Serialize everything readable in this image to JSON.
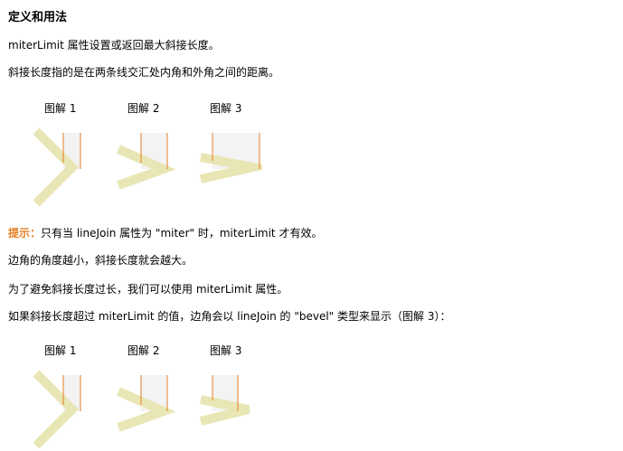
{
  "heading": "定义和用法",
  "p1": "miterLimit 属性设置或返回最大斜接长度。",
  "p2": "斜接长度指的是在两条线交汇处内角和外角之间的距离。",
  "captions_top": [
    "图解 1",
    "图解 2",
    "图解 3"
  ],
  "tip_label": "提示：",
  "tip_text": "只有当 lineJoin 属性为 \"miter\" 时，miterLimit 才有效。",
  "p3": "边角的角度越小，斜接长度就会越大。",
  "p4": "为了避免斜接长度过长，我们可以使用 miterLimit 属性。",
  "p5": "如果斜接长度超过 miterLimit 的值，边角会以 lineJoin 的 \"bevel\" 类型来显示（图解 3）：",
  "captions_bottom": [
    "图解 1",
    "图解 2",
    "图解 3"
  ],
  "colors": {
    "stroke": "#e8e6b5",
    "marker": "#e67e22",
    "band": "#f3f3f3",
    "tip": "#e67e22"
  }
}
